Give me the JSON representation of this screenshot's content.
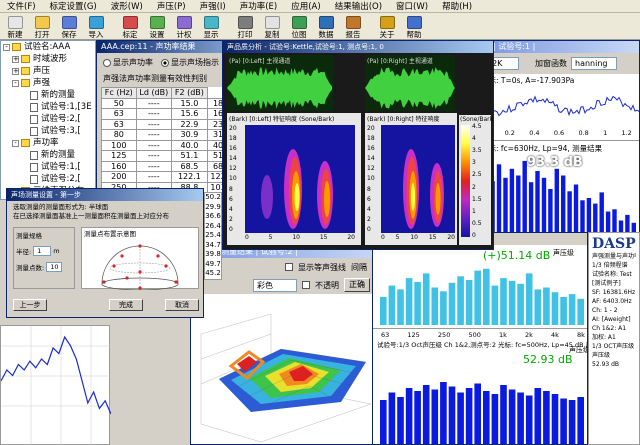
{
  "menu": [
    "文件(F)",
    "标定设置(G)",
    "波形(W)",
    "声压(P)",
    "声强(I)",
    "声功率(E)",
    "应用(A)",
    "结果输出(O)",
    "窗口(W)",
    "帮助(H)"
  ],
  "toolbar": [
    {
      "label": "新建",
      "color": "#e6e6e6"
    },
    {
      "label": "打开",
      "color": "#f2c94c"
    },
    {
      "label": "保存",
      "color": "#5b7fd6"
    },
    {
      "label": "导入",
      "color": "#3aa0d8"
    },
    {
      "label": "标定",
      "color": "#d64b4b"
    },
    {
      "label": "设置",
      "color": "#5ab04f"
    },
    {
      "label": "计权",
      "color": "#8a6bd1"
    },
    {
      "label": "显示",
      "color": "#4ab7c9"
    },
    {
      "label": "打印",
      "color": "#7d7d7d"
    },
    {
      "label": "复制",
      "color": "#e2e2e2"
    },
    {
      "label": "位图",
      "color": "#3f9e55"
    },
    {
      "label": "数据",
      "color": "#2f6fb8"
    },
    {
      "label": "报告",
      "color": "#c0772b"
    },
    {
      "label": "关于",
      "color": "#d4a017"
    },
    {
      "label": "帮助",
      "color": "#4470cc"
    }
  ],
  "tree": [
    {
      "indent": 0,
      "icon": "folder",
      "text": "试验名:AAA",
      "box": "-"
    },
    {
      "indent": 1,
      "icon": "folder",
      "text": "时域波形",
      "box": "+"
    },
    {
      "indent": 1,
      "icon": "folder",
      "text": "声压",
      "box": "+"
    },
    {
      "indent": 1,
      "icon": "folder",
      "text": "声强",
      "box": "-"
    },
    {
      "indent": 2,
      "icon": "doc",
      "text": "新的测量",
      "box": ""
    },
    {
      "indent": 2,
      "icon": "doc",
      "text": "试验号:1,[3E",
      "box": ""
    },
    {
      "indent": 2,
      "icon": "doc",
      "text": "试验号:2,[",
      "box": ""
    },
    {
      "indent": 2,
      "icon": "doc",
      "text": "试验号:3,[",
      "box": ""
    },
    {
      "indent": 1,
      "icon": "folder",
      "text": "声功率",
      "box": "-"
    },
    {
      "indent": 2,
      "icon": "doc",
      "text": "新的测量",
      "box": ""
    },
    {
      "indent": 2,
      "icon": "doc",
      "text": "试验号:1,[",
      "box": ""
    },
    {
      "indent": 2,
      "icon": "doc",
      "text": "试验号:2,[",
      "box": ""
    },
    {
      "indent": 1,
      "icon": "folder",
      "text": "三维声强分布",
      "box": "+"
    }
  ],
  "power_window": {
    "title": "AAA.cep:11 - 声功率结果",
    "radio1": "显示声功率",
    "radio2": "显示声场指示",
    "subtitle": "声强法声功率测量有效性判别",
    "headers": [
      "Fc (Hz)",
      "Ld (dB)",
      "F2 (dB)"
    ],
    "rows": [
      [
        "50",
        "----",
        "15.0"
      ],
      [
        "63",
        "----",
        "15.6"
      ],
      [
        "63",
        "----",
        "22.9"
      ],
      [
        "80",
        "----",
        "30.9"
      ],
      [
        "100",
        "----",
        "40.0"
      ],
      [
        "125",
        "----",
        "51.1"
      ],
      [
        "160",
        "----",
        "68.5"
      ],
      [
        "200",
        "----",
        "122.1"
      ],
      [
        "250",
        "----",
        "88.8"
      ]
    ],
    "extra_col": [
      "18.0",
      "16.0",
      "23.3",
      "31.2",
      "40.6",
      "51.1",
      "68.5",
      "122.1",
      "103.3"
    ],
    "side_values": [
      "50.2",
      "29.9",
      "36.6",
      "26.4",
      "25.4",
      "34.7",
      "39.8",
      "49.7",
      "45.2"
    ]
  },
  "spectrogram_window": {
    "title": "声品质分析 - 试验号:Kettle,试验号:1, 测点号:1, 0",
    "panel_left_top": "(Pa) [0:Left] 主视通道",
    "panel_right_top": "(Pa) [0:Right] 主视通道",
    "panel_left_bottom": "(Bark) [0:Left] 特征响度 (Sone/Bark)",
    "panel_right_bottom": "(Bark) [0:Right] 特征响度",
    "colorbar_title": "(Sone/Bark)",
    "colorbar_ticks": [
      "4.5",
      "4",
      "3.5",
      "3",
      "2.5",
      "2",
      "1.5",
      "1",
      "0.5",
      "0"
    ],
    "y_ticks": [
      "20",
      "18",
      "16",
      "14",
      "12",
      "10",
      "8",
      "6",
      "4",
      "2",
      "0"
    ],
    "x_ticks": [
      "0",
      "5",
      "10",
      "15",
      "20"
    ],
    "x_unit": "(Bark)"
  },
  "right_window": {
    "title": "| 试验号:1 |",
    "dropdown1": "32K",
    "weight_label": "加窗函数",
    "dropdown2": "hanning",
    "info": "光标: T=0s, A=-17.903Pa",
    "wave_xticks": [
      "0",
      "0.2",
      "0.4",
      "0.6",
      "0.8",
      "1",
      "1.2"
    ],
    "wave_unit": "(s)",
    "spec_info": "光标: fc=630Hz, Lp=94, 测量结果",
    "level": "93.3 dB"
  },
  "contour_window": {
    "title": "测量结果 | 试验号:2 |",
    "checkbox1": "显示等声强线",
    "interval_label": "间隔",
    "dropdown": "彩色",
    "checkbox2": "不透明",
    "button": "正确"
  },
  "dialog": {
    "title": "声场测量设置 - 第一步",
    "line1": "选取测量的测量面形式为: 半球面",
    "line2": "在已选择测量面基准上一测量面积在测量面上对应分布",
    "group1": "测量规格",
    "radius_label": "半径:",
    "radius_value": "1",
    "radius_unit": "m",
    "points_label": "测量点数:",
    "points_value": "10",
    "group2": "测量点布置示意图",
    "btn_prev": "上一步",
    "btn_finish": "完成",
    "btn_cancel": "取消"
  },
  "sound_window": {
    "header": "1/3 (Pa): Lp=103.0dB",
    "level_top": "(+)51.14 dB",
    "level_top_label": "声压级",
    "level_bottom": "52.93 dB",
    "level_bottom_label": "声压级",
    "mid_caption": "试验号:1/3 Oct声压级 Ch 1&2,测点号:2 光标: fc=500Hz, Lp=45 dB 声压级",
    "x_ticks": [
      "63",
      "125",
      "250",
      "500",
      "1k",
      "2k",
      "4k",
      "8k"
    ]
  },
  "info_panel": {
    "logo": "DASP",
    "lines": [
      "声强测量与声功率",
      "1/3 倍频程谱",
      "试验名称: Test",
      "[测试例子]",
      "SF: 16381.6Hz",
      "AF: 6403.0Hz",
      "Ch: 1 - 2",
      "AI: [Aweight]",
      "",
      "Ch 1&2: A1",
      "加权: A1",
      "1/3 OCT声压级",
      "声压级",
      "52.93 dB"
    ]
  },
  "colors": {
    "title_active": "#0a246a",
    "waveform_green": "#40d040",
    "bar_blue": "#0a1ae0",
    "bar_cyan": "#3fc2e6"
  },
  "chart_data": [
    {
      "type": "bar",
      "name": "right-spectrum",
      "values": [
        62,
        55,
        70,
        58,
        66,
        60,
        73,
        54,
        64,
        58,
        48,
        66,
        60,
        46,
        52,
        38,
        40,
        35,
        45,
        28,
        30,
        20,
        25,
        18
      ]
    },
    {
      "type": "bar",
      "name": "mid-spectrum",
      "values": [
        30,
        42,
        38,
        50,
        46,
        55,
        40,
        36,
        45,
        52,
        48,
        58,
        60,
        42,
        50,
        47,
        44,
        55,
        38,
        40,
        35,
        30,
        33,
        28
      ]
    },
    {
      "type": "bar",
      "name": "bottom-spectrum",
      "values": [
        30,
        35,
        32,
        38,
        36,
        40,
        37,
        42,
        39,
        35,
        38,
        41,
        36,
        34,
        40,
        37,
        35,
        33,
        38,
        36,
        34,
        31,
        30,
        32
      ]
    },
    {
      "type": "line",
      "name": "left-response",
      "values": [
        5,
        6,
        5.5,
        6.5,
        6,
        6.8,
        6.2,
        7,
        6.5,
        8,
        7.5,
        9,
        8.2,
        7,
        5,
        3,
        4,
        2.5,
        3.2,
        2
      ]
    }
  ]
}
